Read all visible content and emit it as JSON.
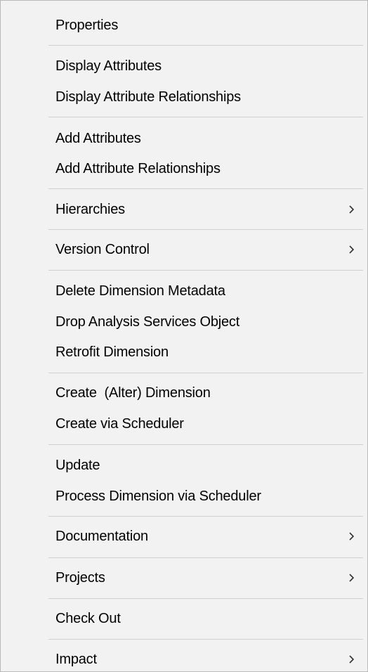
{
  "menu": {
    "items": [
      {
        "label": "Properties",
        "submenu": false
      },
      {
        "label": "Display Attributes",
        "submenu": false
      },
      {
        "label": "Display Attribute Relationships",
        "submenu": false
      },
      {
        "label": "Add Attributes",
        "submenu": false
      },
      {
        "label": "Add Attribute Relationships",
        "submenu": false
      },
      {
        "label": "Hierarchies",
        "submenu": true
      },
      {
        "label": "Version Control",
        "submenu": true
      },
      {
        "label": "Delete Dimension Metadata",
        "submenu": false
      },
      {
        "label": "Drop Analysis Services Object",
        "submenu": false
      },
      {
        "label": "Retrofit Dimension",
        "submenu": false
      },
      {
        "label": "Create  (Alter) Dimension",
        "submenu": false
      },
      {
        "label": "Create via Scheduler",
        "submenu": false
      },
      {
        "label": "Update",
        "submenu": false
      },
      {
        "label": "Process Dimension via Scheduler",
        "submenu": false
      },
      {
        "label": "Documentation",
        "submenu": true
      },
      {
        "label": "Projects",
        "submenu": true
      },
      {
        "label": "Check Out",
        "submenu": false
      },
      {
        "label": "Impact",
        "submenu": true
      }
    ]
  }
}
